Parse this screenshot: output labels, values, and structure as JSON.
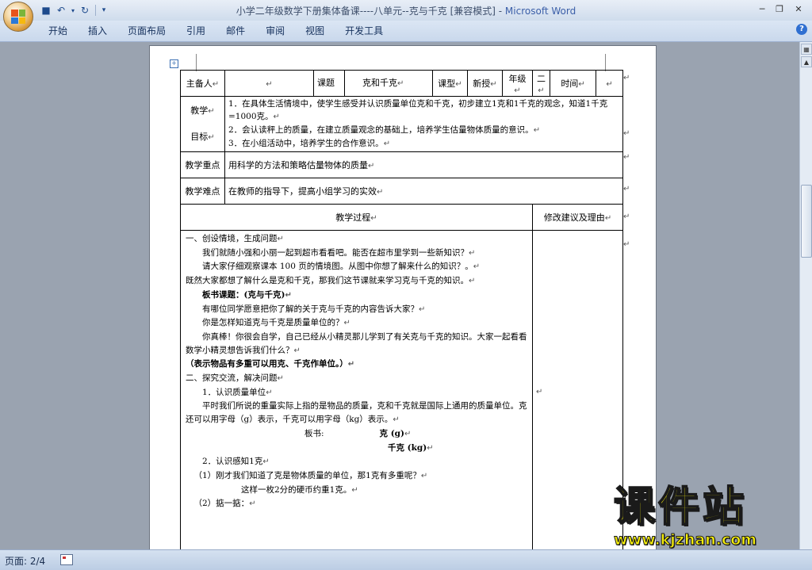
{
  "window": {
    "title": "小学二年级数学下册集体备课----八单元--克与千克 [兼容模式]",
    "app_name": "Microsoft Word",
    "title_separator": " - "
  },
  "ribbon": {
    "tabs": [
      "开始",
      "插入",
      "页面布局",
      "引用",
      "邮件",
      "审阅",
      "视图",
      "开发工具"
    ]
  },
  "status": {
    "page": "页面: 2/4"
  },
  "header_row": {
    "preparer_label": "主备人",
    "topic_label": "课题",
    "topic_value": "克和千克",
    "type_label": "课型",
    "type_value": "新授",
    "grade_label": "年级",
    "grade_value": "二",
    "time_label": "时间"
  },
  "marks": {
    "para": "↵"
  },
  "goals": {
    "label_top": "教学",
    "label_bottom": "目标",
    "items": [
      "1．在具体生活情境中，使学生感受并认识质量单位克和千克，初步建立1克和1千克的观念，知道1千克=1000克。",
      "2．会认读秤上的质量，在建立质量观念的基础上，培养学生估量物体质量的意识。",
      "3．在小组活动中，培养学生的合作意识。"
    ]
  },
  "key_point": {
    "label": "教学重点",
    "text": "用科学的方法和策略估量物体的质量"
  },
  "difficulty": {
    "label": "教学难点",
    "text": "在教师的指导下，提高小组学习的实效"
  },
  "process_header": {
    "left": "教学过程",
    "right": "修改建议及理由"
  },
  "process": {
    "l1": "一、创设情境，生成问题",
    "l2": "我们就随小强和小丽一起到超市看看吧。能否在超市里学到一些新知识？",
    "l3": "请大家仔细观察课本 100 页的情境图。从图中你想了解来什么的知识？。",
    "l4": "既然大家都想了解什么是克和千克，那我们这节课就来学习克与千克的知识。",
    "l5": "板书课题：(克与千克)",
    "l6": "有哪位同学愿意把你了解的关于克与千克的内容告诉大家？",
    "l7": "你是怎样知道克与千克是质量单位的？",
    "l8": "你真棒！你很会自学，自己已经从小精灵那儿学到了有关克与千克的知识。大家一起看看数学小精灵想告诉我们什么？",
    "l9": "（表示物品有多重可以用克、千克作单位。）",
    "l10": "二、探究交流，解决问题",
    "l11": "1．认识质量单位",
    "l12": "平时我们所说的重量实际上指的是物品的质量，克和千克就是国际上通用的质量单位。克还可以用字母（g）表示，千克可以用字母（kg）表示。",
    "l13_label": "板书:",
    "l13_value": "克 (g)",
    "l14_value": "千克 (kg)",
    "l15": "2．认识感知1克",
    "l16": "（1）刚才我们知道了克是物体质量的单位，那1克有多重呢？",
    "l17": "这样一枚2分的硬币约重1克。",
    "l18": "（2）掂一掂："
  },
  "watermark": {
    "brand": "课件站",
    "url": "www.kjzhan.com"
  }
}
